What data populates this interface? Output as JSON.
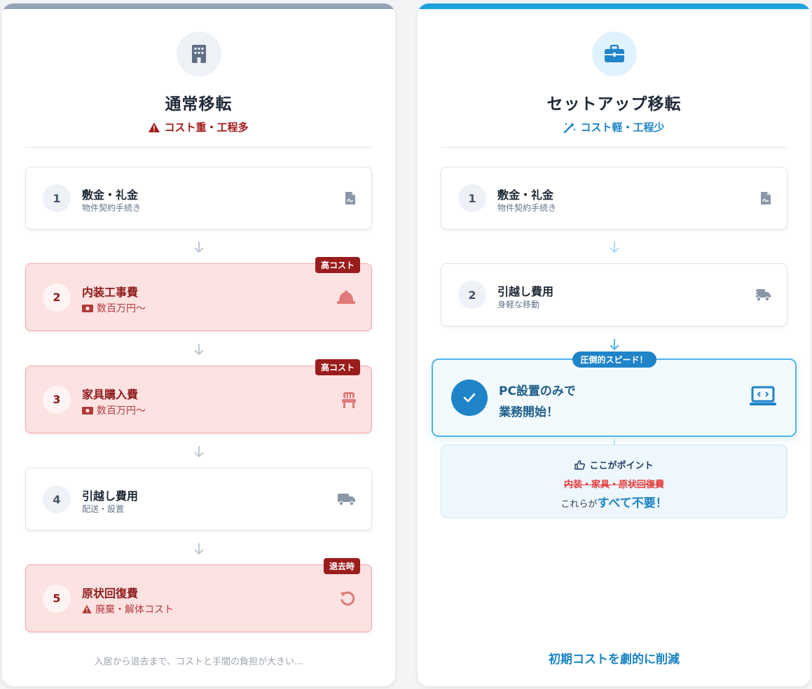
{
  "left": {
    "title": "通常移転",
    "subtitle": "コスト重・工程多",
    "steps": [
      {
        "num": "1",
        "label": "敷金・礼金",
        "sub": "物件契約手続き"
      },
      {
        "num": "2",
        "label": "内装工事費",
        "sub": "数百万円〜",
        "badge": "高コスト"
      },
      {
        "num": "3",
        "label": "家具購入費",
        "sub": "数百万円〜",
        "badge": "高コスト"
      },
      {
        "num": "4",
        "label": "引越し費用",
        "sub": "配送・設置"
      },
      {
        "num": "5",
        "label": "原状回復費",
        "sub": "廃棄・解体コスト",
        "badge": "退去時"
      }
    ],
    "footer": "入居から退去まで、コストと手間の負担が大きい..."
  },
  "right": {
    "title": "セットアップ移転",
    "subtitle": "コスト軽・工程少",
    "steps": [
      {
        "num": "1",
        "label": "敷金・礼金",
        "sub": "物件契約手続き"
      },
      {
        "num": "2",
        "label": "引越し費用",
        "sub": "身軽な移動"
      }
    ],
    "hero": {
      "badge": "圧倒的スピード！",
      "line1": "PC設置のみで",
      "line2": "業務開始！"
    },
    "point": {
      "title": "ここがポイント",
      "strike": "内装・家具・原状回復費",
      "prefix": "これらが",
      "emphasis": "すべて不要！"
    },
    "footer": "初期コストを劇的に削減"
  },
  "colors": {
    "danger": "#9b1c1c",
    "accent": "#1f84c8",
    "left_bar": "#94a3b8",
    "right_bar": "#1fa0e0"
  }
}
